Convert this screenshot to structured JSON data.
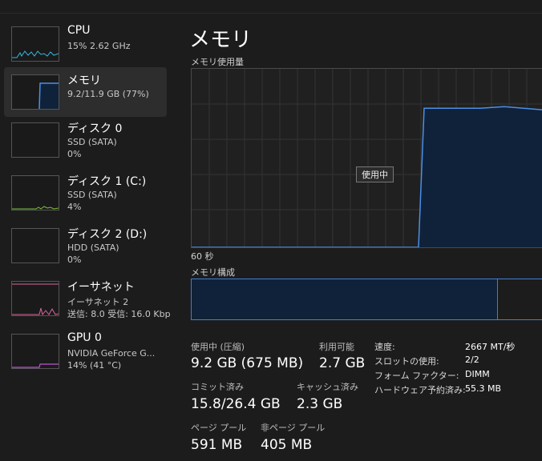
{
  "sidebar": {
    "items": [
      {
        "name": "CPU",
        "sub1": "15%  2.62 GHz",
        "sub2": ""
      },
      {
        "name": "メモリ",
        "sub1": "9.2/11.9 GB (77%)",
        "sub2": ""
      },
      {
        "name": "ディスク 0",
        "sub1": "SSD (SATA)",
        "sub2": "0%"
      },
      {
        "name": "ディスク 1 (C:)",
        "sub1": "SSD (SATA)",
        "sub2": "4%"
      },
      {
        "name": "ディスク 2 (D:)",
        "sub1": "HDD (SATA)",
        "sub2": "0%"
      },
      {
        "name": "イーサネット",
        "sub1": "イーサネット 2",
        "sub2": "送信: 8.0  受信: 16.0 Kbp"
      },
      {
        "name": "GPU 0",
        "sub1": "NVIDIA GeForce G...",
        "sub2": "14%  (41 °C)"
      }
    ]
  },
  "main": {
    "title": "メモリ",
    "usage_label": "メモリ使用量",
    "time_label": "60 秒",
    "tooltip": "使用中",
    "composition_label": "メモリ構成",
    "usage_fraction": 0.77
  },
  "stats": {
    "in_use_label": "使用中 (圧縮)",
    "in_use_value": "9.2 GB (675 MB)",
    "available_label": "利用可能",
    "available_value": "2.7 GB",
    "committed_label": "コミット済み",
    "committed_value": "15.8/26.4 GB",
    "cached_label": "キャッシュ済み",
    "cached_value": "2.3 GB",
    "paged_label": "ページ プール",
    "paged_value": "591 MB",
    "nonpaged_label": "非ページ プール",
    "nonpaged_value": "405 MB"
  },
  "details": [
    {
      "key": "速度:",
      "value": "2667 MT/秒"
    },
    {
      "key": "スロットの使用:",
      "value": "2/2"
    },
    {
      "key": "フォーム ファクター:",
      "value": "DIMM"
    },
    {
      "key": "ハードウェア予約済み:",
      "value": "55.3 MB"
    }
  ],
  "colors": {
    "memory": "#4a8fe7",
    "cpu": "#36b6e0",
    "disk": "#7fbf3f",
    "ethernet": "#d9649b",
    "gpu": "#c052d8"
  }
}
